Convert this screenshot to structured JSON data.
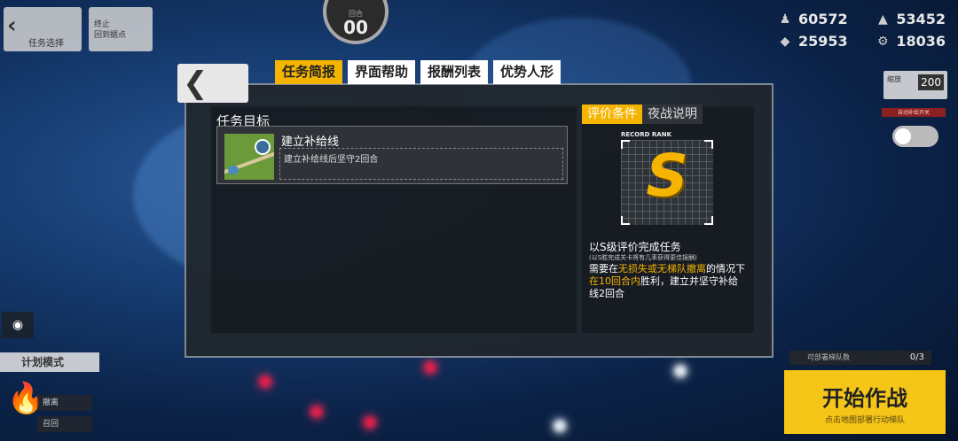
{
  "top_left": {
    "back_label": "任务选择",
    "back_arrow": "‹",
    "btn2_line1": "终止",
    "btn2_line2": "回到据点"
  },
  "turn": {
    "label": "回合",
    "value": "00"
  },
  "resources": [
    {
      "icon": "manpower-icon",
      "glyph": "♟",
      "value": "60572"
    },
    {
      "icon": "ammo-icon",
      "glyph": "▲",
      "value": "53452"
    },
    {
      "icon": "ration-icon",
      "glyph": "◆",
      "value": "25953"
    },
    {
      "icon": "parts-icon",
      "glyph": "⚙",
      "value": "18036"
    }
  ],
  "zoom": {
    "label": "缩放",
    "value": "200"
  },
  "toggle_label": "自动补给开关",
  "left_controls": {
    "eye_glyph": "◉",
    "plan_label": "计划模式",
    "btn_a": "撤离",
    "btn_b": "召回"
  },
  "bottom_right": {
    "echelon_label": "可部署梯队数",
    "echelon_count": "0/3",
    "start_label": "开始作战",
    "start_sub": "点击地图部署行动梯队"
  },
  "back_tab": {
    "glyph": "❮"
  },
  "tabs": [
    "任务简报",
    "界面帮助",
    "报酬列表",
    "优势人形"
  ],
  "objective": {
    "title": "任务目标",
    "name": "建立补给线",
    "desc": "建立补给线后坚守2回合"
  },
  "right_tabs": [
    "评价条件",
    "夜战说明"
  ],
  "rank": {
    "label": "RECORD RANK",
    "letter": "S"
  },
  "condition": {
    "title": "以S级评价完成任务",
    "note": "(以S胜完成关卡将有几率获得更佳报酬)",
    "p1": "需要在",
    "p1_hl": "无损失或无梯队撤离",
    "p1_end": "的情况下",
    "p2_hl": "在10回合内",
    "p2_end": "胜利，建立并坚守补给线2回合"
  }
}
